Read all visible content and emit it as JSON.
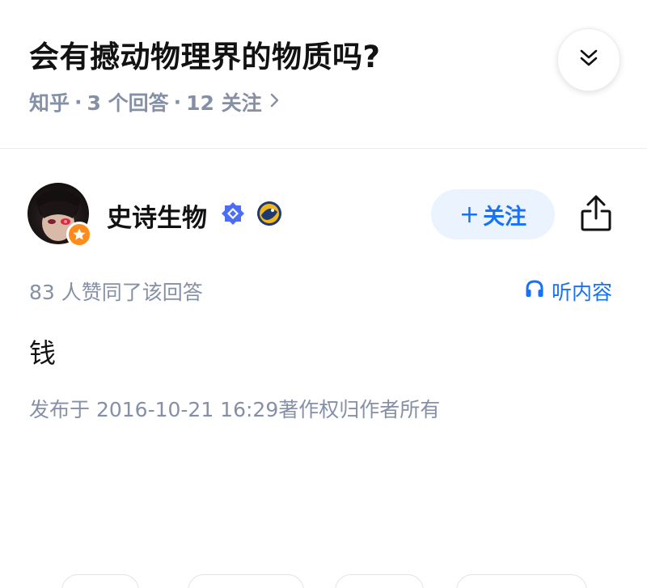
{
  "question": {
    "title": "会有撼动物理界的物质吗?",
    "source": "知乎",
    "answers": "3 个回答",
    "follows": "12 关注",
    "separator": "·"
  },
  "author": {
    "name": "史诗生物",
    "follow_label": "关注",
    "follow_plus": "+"
  },
  "answer": {
    "upvotes": "83 人赞同了该回答",
    "listen_label": "听内容",
    "content": "钱",
    "publish_info": "发布于 2016-10-21 16:29著作权归作者所有"
  },
  "colors": {
    "brand_blue": "#1772f6",
    "meta_gray": "#8590a6",
    "badge_orange": "#ff8c1a"
  },
  "icons": [
    "chevron-double-down-icon",
    "chevron-right-icon",
    "verified-icon",
    "medal-icon",
    "share-icon",
    "headphones-icon",
    "star-badge-icon"
  ]
}
